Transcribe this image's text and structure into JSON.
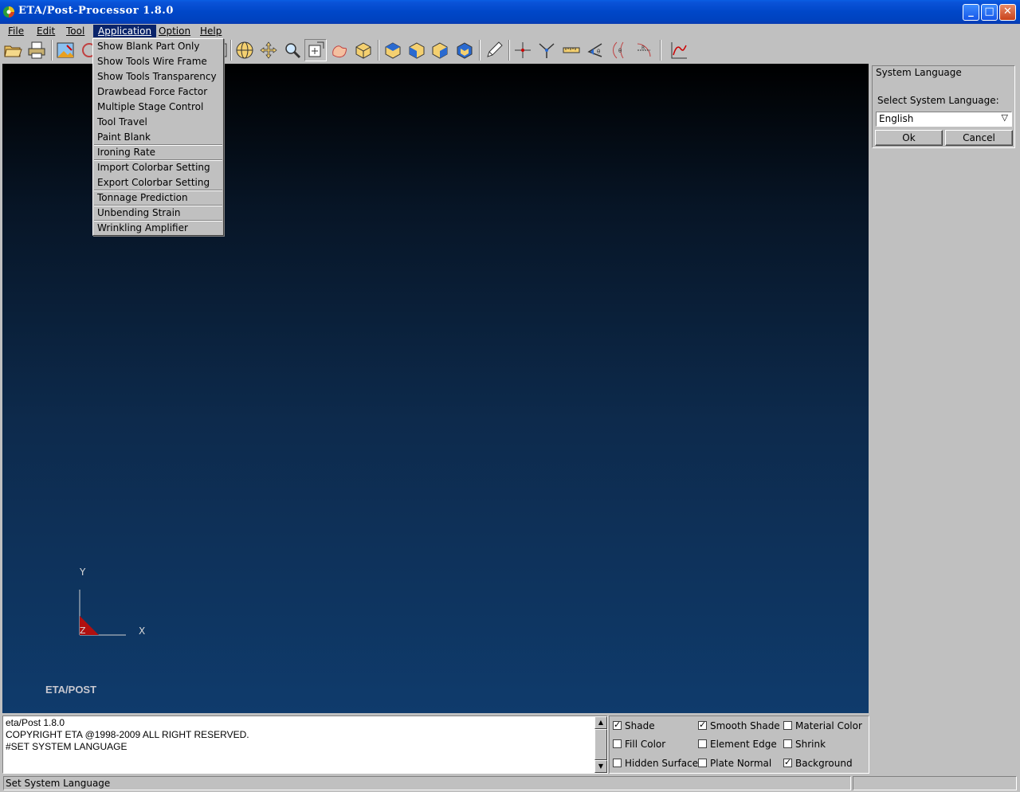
{
  "window": {
    "title": "ETA/Post-Processor  1.8.0",
    "icon": "eta-app-icon",
    "controls": {
      "minimize": "_",
      "maximize": "□",
      "close": "✕"
    }
  },
  "menubar": {
    "items": [
      {
        "label": "File"
      },
      {
        "label": "Edit"
      },
      {
        "label": "Tool"
      },
      {
        "label": "Application"
      },
      {
        "label": "Option"
      },
      {
        "label": "Help"
      }
    ],
    "active": "Application"
  },
  "application_menu": {
    "items": [
      "Show Blank Part Only",
      "Show Tools Wire Frame",
      "Show Tools Transparency",
      "Drawbead Force Factor",
      "Multiple Stage Control",
      "Tool Travel",
      "Paint Blank",
      "Ironing Rate",
      "Import Colorbar Setting",
      "Export Colorbar Setting",
      "Tonnage Prediction",
      "Unbending Strain",
      "Wrinkling Amplifier"
    ]
  },
  "toolbar": {
    "icons": [
      "open-folder-icon",
      "print-icon",
      "image-export-icon",
      "rotate-sphere-icon",
      "pan-icon",
      "zoom-icon",
      "zoom-window-icon",
      "freehand-zoom-icon",
      "iso-view-icon",
      "top-view-icon",
      "front-view-icon",
      "side-view-icon",
      "normal-view-icon",
      "pen-icon",
      "node-pick-icon",
      "vertex-pick-icon",
      "measure-ruler-icon",
      "angle-icon",
      "arc-angle-icon",
      "radius-icon",
      "graph-plot-icon"
    ]
  },
  "viewport": {
    "axis": {
      "y": "Y",
      "x": "X",
      "z": "Z"
    },
    "watermark": "ETA/POST",
    "background_top": "#000000",
    "background_bottom": "#0f3b6c"
  },
  "system_language": {
    "title": "System Language",
    "prompt": "Select System Language:",
    "selected": "English",
    "ok_label": "Ok",
    "cancel_label": "Cancel"
  },
  "console": {
    "lines": [
      "eta/Post 1.8.0",
      "COPYRIGHT ETA @1998-2009 ALL RIGHT RESERVED.",
      "#SET SYSTEM LANGUAGE"
    ]
  },
  "display_options": [
    {
      "label": "Shade",
      "checked": true
    },
    {
      "label": "Smooth Shade",
      "checked": true
    },
    {
      "label": "Material Color",
      "checked": false
    },
    {
      "label": "Fill Color",
      "checked": false
    },
    {
      "label": "Element Edge",
      "checked": false
    },
    {
      "label": "Shrink",
      "checked": false
    },
    {
      "label": "Hidden Surface",
      "checked": false
    },
    {
      "label": "Plate Normal",
      "checked": false
    },
    {
      "label": "Background",
      "checked": true
    }
  ],
  "status": {
    "text": "Set System Language"
  },
  "colors": {
    "titlebar": "#0047c8",
    "menu_highlight": "#0a246a",
    "chrome": "#c0c0c0"
  }
}
